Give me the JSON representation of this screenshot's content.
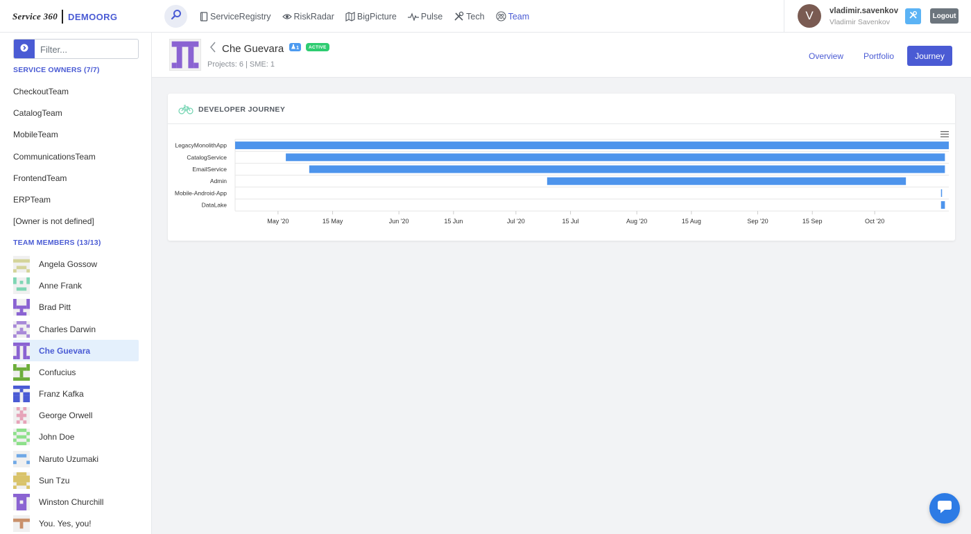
{
  "header": {
    "logo_text": "Service 360",
    "org": "DEMOORG",
    "nav": [
      {
        "label": "ServiceRegistry",
        "icon": "file-icon"
      },
      {
        "label": "RiskRadar",
        "icon": "eye-icon"
      },
      {
        "label": "BigPicture",
        "icon": "map-icon"
      },
      {
        "label": "Pulse",
        "icon": "pulse-icon"
      },
      {
        "label": "Tech",
        "icon": "tools-icon"
      },
      {
        "label": "Team",
        "icon": "team-icon"
      }
    ],
    "active_nav": "Team",
    "user": {
      "initial": "V",
      "login": "vladimir.savenkov",
      "name": "Vladimir Savenkov"
    },
    "logout_label": "Logout"
  },
  "sidebar": {
    "filter_placeholder": "Filter...",
    "owners_heading": "SERVICE OWNERS (7/7)",
    "owners": [
      "CheckoutTeam",
      "CatalogTeam",
      "MobileTeam",
      "CommunicationsTeam",
      "FrontendTeam",
      "ERPTeam",
      "[Owner is not defined]"
    ],
    "members_heading": "TEAM MEMBERS (13/13)",
    "members": [
      {
        "name": "Angela Gossow",
        "color": "#d4d49a"
      },
      {
        "name": "Anne Frank",
        "color": "#7fd6b4"
      },
      {
        "name": "Brad Pitt",
        "color": "#8a63d2"
      },
      {
        "name": "Charles Darwin",
        "color": "#a889d8"
      },
      {
        "name": "Che Guevara",
        "color": "#8a63d2"
      },
      {
        "name": "Confucius",
        "color": "#6cad3a"
      },
      {
        "name": "Franz Kafka",
        "color": "#4a5bd4"
      },
      {
        "name": "George Orwell",
        "color": "#e6a3b8"
      },
      {
        "name": "John Doe",
        "color": "#8de08a"
      },
      {
        "name": "Naruto Uzumaki",
        "color": "#6fa8e6"
      },
      {
        "name": "Sun Tzu",
        "color": "#d9c36a"
      },
      {
        "name": "Winston Churchill",
        "color": "#8a63d2"
      },
      {
        "name": "You. Yes, you!",
        "color": "#c9906a"
      }
    ],
    "selected_member": "Che Guevara"
  },
  "profile": {
    "name": "Che Guevara",
    "sme_badge": "1",
    "status_badge": "ACTIVE",
    "subtitle": "Projects: 6 | SME: 1",
    "tabs": [
      "Overview",
      "Portfolio",
      "Journey"
    ],
    "active_tab": "Journey"
  },
  "card": {
    "title": "DEVELOPER JOURNEY"
  },
  "colors": {
    "accent": "#4a5bd4",
    "bar": "#4d94ec",
    "active_badge": "#2ecc71"
  },
  "chart_data": {
    "type": "bar",
    "orientation": "horizontal-timeline",
    "categories": [
      "LegacyMonolithApp",
      "CatalogService",
      "EmailService",
      "Admin",
      "Mobile-Android-App",
      "DataLake"
    ],
    "ranges": [
      {
        "start": "2020-04-20",
        "end": "2020-10-20"
      },
      {
        "start": "2020-05-03",
        "end": "2020-10-19"
      },
      {
        "start": "2020-05-09",
        "end": "2020-10-19"
      },
      {
        "start": "2020-07-09",
        "end": "2020-10-09"
      },
      {
        "start": "2020-10-18",
        "end": "2020-10-18"
      },
      {
        "start": "2020-10-18",
        "end": "2020-10-19"
      }
    ],
    "x_ticks": [
      "May '20",
      "15 May",
      "Jun '20",
      "15 Jun",
      "Jul '20",
      "15 Jul",
      "Aug '20",
      "15 Aug",
      "Sep '20",
      "15 Sep",
      "Oct '20"
    ],
    "xlim": [
      "2020-04-20",
      "2020-10-20"
    ]
  }
}
